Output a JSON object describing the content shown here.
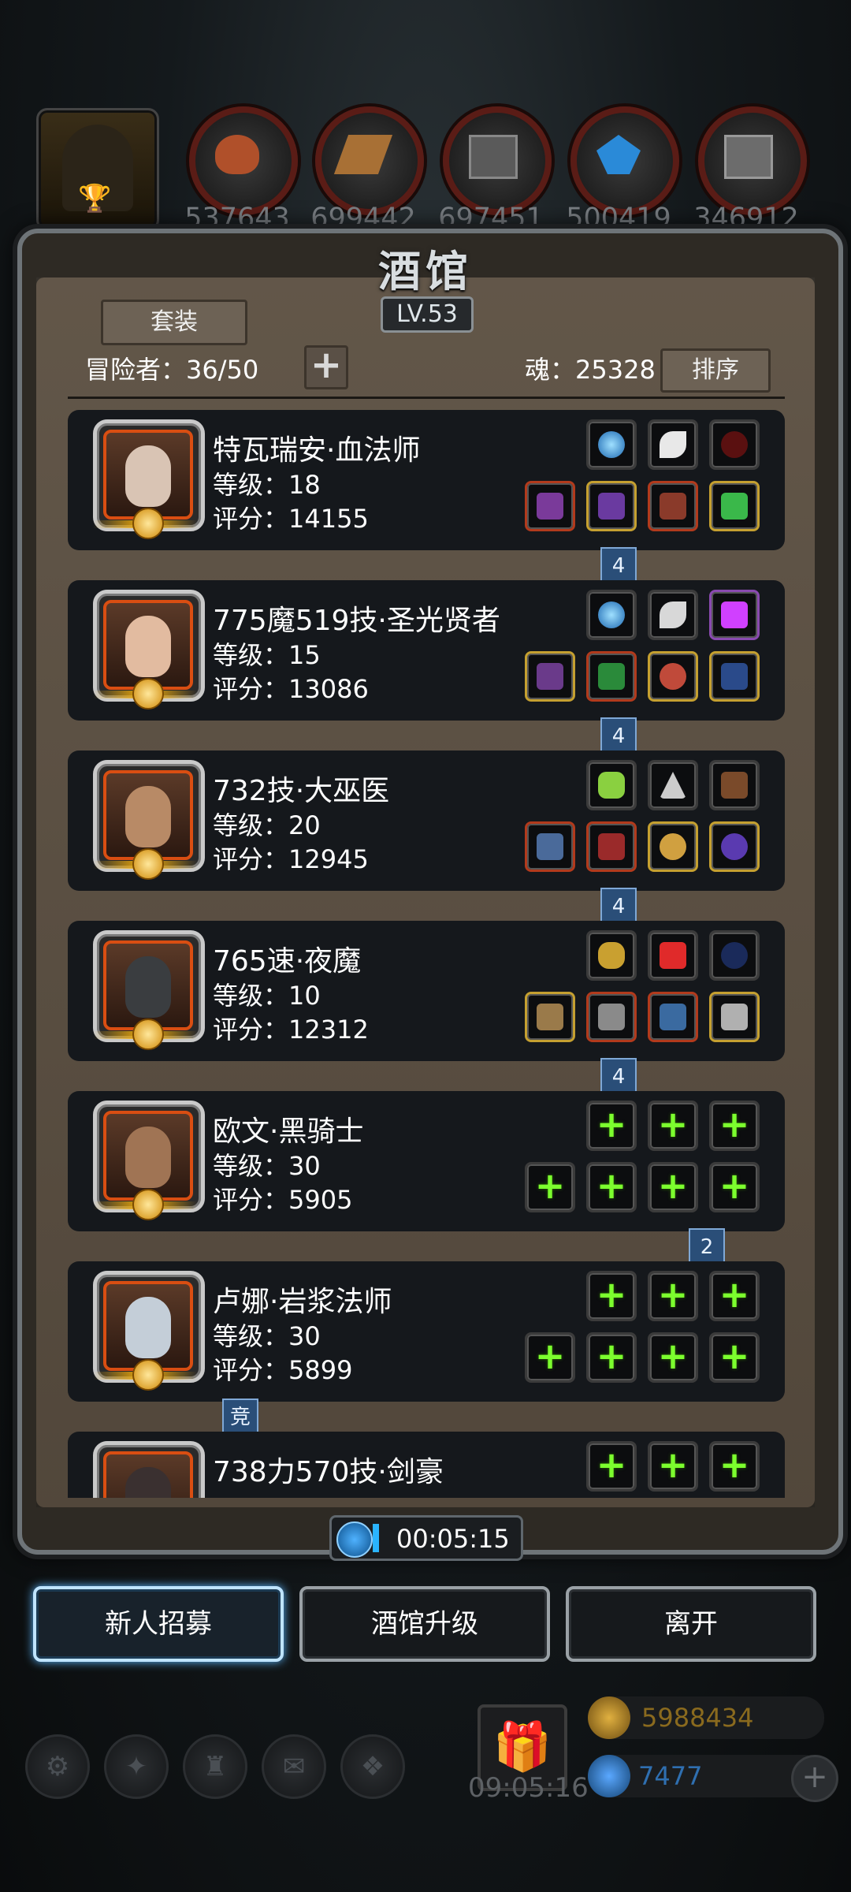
{
  "top_resources": {
    "portrait_icon": "hooded-adventurer-trophy-icon",
    "items": [
      {
        "icon": "ore-icon",
        "value": "537643"
      },
      {
        "icon": "wood-icon",
        "value": "699442"
      },
      {
        "icon": "iron-ingot-icon",
        "value": "697451"
      },
      {
        "icon": "crystal-icon",
        "value": "500419"
      },
      {
        "icon": "steel-icon",
        "value": "346912"
      }
    ]
  },
  "panel": {
    "title": "酒馆",
    "level": "LV.53",
    "suit_button": "套装",
    "adventurers_label": "冒险者：36/50",
    "soul_label": "魂：25328",
    "sort_button": "排序",
    "add_icon": "+"
  },
  "heroes": [
    {
      "name": "特瓦瑞安·血法师",
      "level": "等级：18",
      "score": "评分：14155",
      "tag": "4",
      "tag_side": "right",
      "empty": false
    },
    {
      "name": "775魔519技·圣光贤者",
      "level": "等级：15",
      "score": "评分：13086",
      "tag": "4",
      "tag_side": "right",
      "empty": false
    },
    {
      "name": "732技·大巫医",
      "level": "等级：20",
      "score": "评分：12945",
      "tag": "4",
      "tag_side": "right",
      "empty": false
    },
    {
      "name": "765速·夜魔",
      "level": "等级：10",
      "score": "评分：12312",
      "tag": "4",
      "tag_side": "right",
      "empty": false
    },
    {
      "name": "欧文·黑骑士",
      "level": "等级：30",
      "score": "评分：5905",
      "tag": "2",
      "tag_side": "far",
      "empty": true
    },
    {
      "name": "卢娜·岩浆法师",
      "level": "等级：30",
      "score": "评分：5899",
      "tag": "竞",
      "tag_side": "left",
      "empty": true
    },
    {
      "name": "738力570技·剑豪",
      "level": "",
      "score": "",
      "tag": "",
      "tag_side": "",
      "empty": true
    }
  ],
  "timer": "00:05:15",
  "buttons": {
    "recruit": "新人招募",
    "upgrade": "酒馆升级",
    "leave": "离开"
  },
  "footer": {
    "gift_timer": "09:05:16",
    "gold": "5988434",
    "gems": "7477",
    "colors": {
      "gold": "#8a6a1e",
      "gems": "#2f6fb0"
    }
  }
}
